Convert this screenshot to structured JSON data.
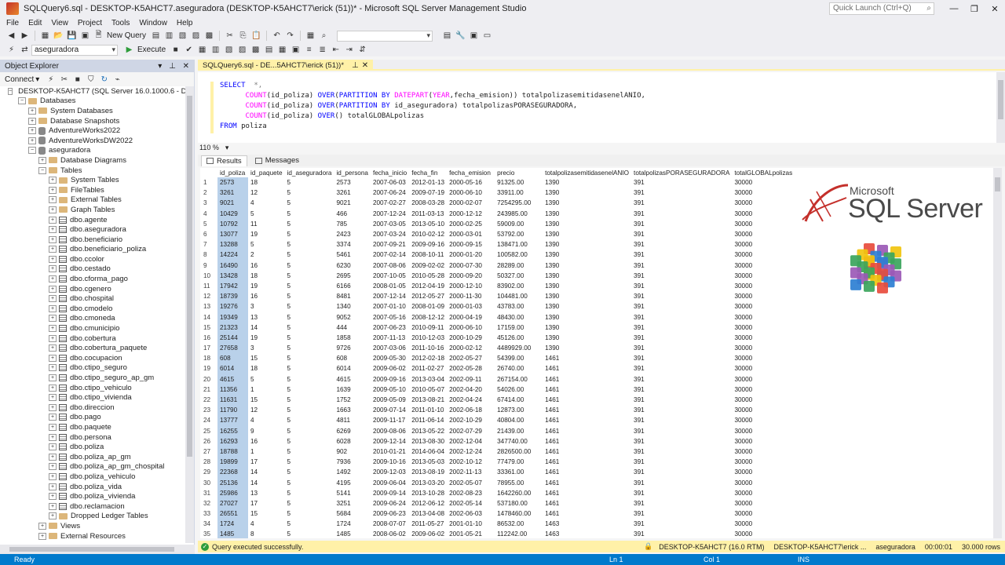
{
  "window": {
    "title": "SQLQuery6.sql - DESKTOP-K5AHCT7.aseguradora (DESKTOP-K5AHCT7\\erick (51))* - Microsoft SQL Server Management Studio",
    "quick_launch_placeholder": "Quick Launch (Ctrl+Q)"
  },
  "menu": [
    "File",
    "Edit",
    "View",
    "Project",
    "Tools",
    "Window",
    "Help"
  ],
  "toolbar": {
    "new_query": "New Query",
    "database": "aseguradora",
    "execute": "Execute"
  },
  "object_explorer": {
    "title": "Object Explorer",
    "connect": "Connect",
    "tree": [
      {
        "label": "DESKTOP-K5AHCT7 (SQL Server 16.0.1000.6 - DESKTOP-K",
        "level": 0,
        "icon": "server",
        "exp": "-"
      },
      {
        "label": "Databases",
        "level": 1,
        "icon": "folder",
        "exp": "-"
      },
      {
        "label": "System Databases",
        "level": 2,
        "icon": "folder",
        "exp": "+"
      },
      {
        "label": "Database Snapshots",
        "level": 2,
        "icon": "folder",
        "exp": "+"
      },
      {
        "label": "AdventureWorks2022",
        "level": 2,
        "icon": "db",
        "exp": "+"
      },
      {
        "label": "AdventureWorksDW2022",
        "level": 2,
        "icon": "db",
        "exp": "+"
      },
      {
        "label": "aseguradora",
        "level": 2,
        "icon": "db",
        "exp": "-"
      },
      {
        "label": "Database Diagrams",
        "level": 3,
        "icon": "folder",
        "exp": "+"
      },
      {
        "label": "Tables",
        "level": 3,
        "icon": "folder",
        "exp": "-"
      },
      {
        "label": "System Tables",
        "level": 4,
        "icon": "folder",
        "exp": "+"
      },
      {
        "label": "FileTables",
        "level": 4,
        "icon": "folder",
        "exp": "+"
      },
      {
        "label": "External Tables",
        "level": 4,
        "icon": "folder",
        "exp": "+"
      },
      {
        "label": "Graph Tables",
        "level": 4,
        "icon": "folder",
        "exp": "+"
      },
      {
        "label": "dbo.agente",
        "level": 4,
        "icon": "table",
        "exp": "+"
      },
      {
        "label": "dbo.aseguradora",
        "level": 4,
        "icon": "table",
        "exp": "+"
      },
      {
        "label": "dbo.beneficiario",
        "level": 4,
        "icon": "table",
        "exp": "+"
      },
      {
        "label": "dbo.beneficiario_poliza",
        "level": 4,
        "icon": "table",
        "exp": "+"
      },
      {
        "label": "dbo.ccolor",
        "level": 4,
        "icon": "table",
        "exp": "+"
      },
      {
        "label": "dbo.cestado",
        "level": 4,
        "icon": "table",
        "exp": "+"
      },
      {
        "label": "dbo.cforma_pago",
        "level": 4,
        "icon": "table",
        "exp": "+"
      },
      {
        "label": "dbo.cgenero",
        "level": 4,
        "icon": "table",
        "exp": "+"
      },
      {
        "label": "dbo.chospital",
        "level": 4,
        "icon": "table",
        "exp": "+"
      },
      {
        "label": "dbo.cmodelo",
        "level": 4,
        "icon": "table",
        "exp": "+"
      },
      {
        "label": "dbo.cmoneda",
        "level": 4,
        "icon": "table",
        "exp": "+"
      },
      {
        "label": "dbo.cmunicipio",
        "level": 4,
        "icon": "table",
        "exp": "+"
      },
      {
        "label": "dbo.cobertura",
        "level": 4,
        "icon": "table",
        "exp": "+"
      },
      {
        "label": "dbo.cobertura_paquete",
        "level": 4,
        "icon": "table",
        "exp": "+"
      },
      {
        "label": "dbo.cocupacion",
        "level": 4,
        "icon": "table",
        "exp": "+"
      },
      {
        "label": "dbo.ctipo_seguro",
        "level": 4,
        "icon": "table",
        "exp": "+"
      },
      {
        "label": "dbo.ctipo_seguro_ap_gm",
        "level": 4,
        "icon": "table",
        "exp": "+"
      },
      {
        "label": "dbo.ctipo_vehiculo",
        "level": 4,
        "icon": "table",
        "exp": "+"
      },
      {
        "label": "dbo.ctipo_vivienda",
        "level": 4,
        "icon": "table",
        "exp": "+"
      },
      {
        "label": "dbo.direccion",
        "level": 4,
        "icon": "table",
        "exp": "+"
      },
      {
        "label": "dbo.pago",
        "level": 4,
        "icon": "table",
        "exp": "+"
      },
      {
        "label": "dbo.paquete",
        "level": 4,
        "icon": "table",
        "exp": "+"
      },
      {
        "label": "dbo.persona",
        "level": 4,
        "icon": "table",
        "exp": "+"
      },
      {
        "label": "dbo.poliza",
        "level": 4,
        "icon": "table",
        "exp": "+"
      },
      {
        "label": "dbo.poliza_ap_gm",
        "level": 4,
        "icon": "table",
        "exp": "+"
      },
      {
        "label": "dbo.poliza_ap_gm_chospital",
        "level": 4,
        "icon": "table",
        "exp": "+"
      },
      {
        "label": "dbo.poliza_vehiculo",
        "level": 4,
        "icon": "table",
        "exp": "+"
      },
      {
        "label": "dbo.poliza_vida",
        "level": 4,
        "icon": "table",
        "exp": "+"
      },
      {
        "label": "dbo.poliza_vivienda",
        "level": 4,
        "icon": "table",
        "exp": "+"
      },
      {
        "label": "dbo.reclamacion",
        "level": 4,
        "icon": "table",
        "exp": "+"
      },
      {
        "label": "Dropped Ledger Tables",
        "level": 4,
        "icon": "folder",
        "exp": "+"
      },
      {
        "label": "Views",
        "level": 3,
        "icon": "folder",
        "exp": "+"
      },
      {
        "label": "External Resources",
        "level": 3,
        "icon": "folder",
        "exp": "+"
      }
    ]
  },
  "editor": {
    "tab_label": "SQLQuery6.sql - DE...5AHCT7\\erick (51))*",
    "zoom": "110 %"
  },
  "results": {
    "tabs": [
      "Results",
      "Messages"
    ],
    "columns": [
      "id_poliza",
      "id_paquete",
      "id_aseguradora",
      "id_persona",
      "fecha_inicio",
      "fecha_fin",
      "fecha_emision",
      "precio",
      "totalpolizasemitidasenelANIO",
      "totalpolizasPORASEGURADORA",
      "totalGLOBALpolizas"
    ],
    "rows": [
      [
        "1",
        "2573",
        "18",
        "5",
        "2573",
        "2007-06-03",
        "2012-01-13",
        "2000-05-16",
        "91325.00",
        "1390",
        "391",
        "30000"
      ],
      [
        "2",
        "3261",
        "12",
        "5",
        "3261",
        "2007-06-24",
        "2009-07-19",
        "2000-06-10",
        "33911.00",
        "1390",
        "391",
        "30000"
      ],
      [
        "3",
        "9021",
        "4",
        "5",
        "9021",
        "2007-02-27",
        "2008-03-28",
        "2000-02-07",
        "7254295.00",
        "1390",
        "391",
        "30000"
      ],
      [
        "4",
        "10429",
        "5",
        "5",
        "466",
        "2007-12-24",
        "2011-03-13",
        "2000-12-12",
        "243985.00",
        "1390",
        "391",
        "30000"
      ],
      [
        "5",
        "10792",
        "11",
        "5",
        "785",
        "2007-03-05",
        "2013-05-10",
        "2000-02-25",
        "59009.00",
        "1390",
        "391",
        "30000"
      ],
      [
        "6",
        "13077",
        "19",
        "5",
        "2423",
        "2007-03-24",
        "2010-02-12",
        "2000-03-01",
        "53792.00",
        "1390",
        "391",
        "30000"
      ],
      [
        "7",
        "13288",
        "5",
        "5",
        "3374",
        "2007-09-21",
        "2009-09-16",
        "2000-09-15",
        "138471.00",
        "1390",
        "391",
        "30000"
      ],
      [
        "8",
        "14224",
        "2",
        "5",
        "5461",
        "2007-02-14",
        "2008-10-11",
        "2000-01-20",
        "100582.00",
        "1390",
        "391",
        "30000"
      ],
      [
        "9",
        "16490",
        "16",
        "5",
        "6230",
        "2007-08-06",
        "2009-02-02",
        "2000-07-30",
        "28289.00",
        "1390",
        "391",
        "30000"
      ],
      [
        "10",
        "13428",
        "18",
        "5",
        "2695",
        "2007-10-05",
        "2010-05-28",
        "2000-09-20",
        "50327.00",
        "1390",
        "391",
        "30000"
      ],
      [
        "11",
        "17942",
        "19",
        "5",
        "6166",
        "2008-01-05",
        "2012-04-19",
        "2000-12-10",
        "83902.00",
        "1390",
        "391",
        "30000"
      ],
      [
        "12",
        "18739",
        "16",
        "5",
        "8481",
        "2007-12-14",
        "2012-05-27",
        "2000-11-30",
        "104481.00",
        "1390",
        "391",
        "30000"
      ],
      [
        "13",
        "19276",
        "3",
        "5",
        "1340",
        "2007-01-10",
        "2008-01-09",
        "2000-01-03",
        "43783.00",
        "1390",
        "391",
        "30000"
      ],
      [
        "14",
        "19349",
        "13",
        "5",
        "9052",
        "2007-05-16",
        "2008-12-12",
        "2000-04-19",
        "48430.00",
        "1390",
        "391",
        "30000"
      ],
      [
        "15",
        "21323",
        "14",
        "5",
        "444",
        "2007-06-23",
        "2010-09-11",
        "2000-06-10",
        "17159.00",
        "1390",
        "391",
        "30000"
      ],
      [
        "16",
        "25144",
        "19",
        "5",
        "1858",
        "2007-11-13",
        "2010-12-03",
        "2000-10-29",
        "45126.00",
        "1390",
        "391",
        "30000"
      ],
      [
        "17",
        "27658",
        "3",
        "5",
        "9726",
        "2007-03-06",
        "2011-10-16",
        "2000-02-12",
        "4489929.00",
        "1390",
        "391",
        "30000"
      ],
      [
        "18",
        "608",
        "15",
        "5",
        "608",
        "2009-05-30",
        "2012-02-18",
        "2002-05-27",
        "54399.00",
        "1461",
        "391",
        "30000"
      ],
      [
        "19",
        "6014",
        "18",
        "5",
        "6014",
        "2009-06-02",
        "2011-02-27",
        "2002-05-28",
        "26740.00",
        "1461",
        "391",
        "30000"
      ],
      [
        "20",
        "4615",
        "5",
        "5",
        "4615",
        "2009-09-16",
        "2013-03-04",
        "2002-09-11",
        "267154.00",
        "1461",
        "391",
        "30000"
      ],
      [
        "21",
        "11356",
        "1",
        "5",
        "1639",
        "2009-05-10",
        "2010-05-07",
        "2002-04-20",
        "54026.00",
        "1461",
        "391",
        "30000"
      ],
      [
        "22",
        "11631",
        "15",
        "5",
        "1752",
        "2009-05-09",
        "2013-08-21",
        "2002-04-24",
        "67414.00",
        "1461",
        "391",
        "30000"
      ],
      [
        "23",
        "11790",
        "12",
        "5",
        "1663",
        "2009-07-14",
        "2011-01-10",
        "2002-06-18",
        "12873.00",
        "1461",
        "391",
        "30000"
      ],
      [
        "24",
        "13777",
        "4",
        "5",
        "4811",
        "2009-11-17",
        "2011-06-14",
        "2002-10-29",
        "40804.00",
        "1461",
        "391",
        "30000"
      ],
      [
        "25",
        "16255",
        "9",
        "5",
        "6269",
        "2009-08-06",
        "2013-05-22",
        "2002-07-29",
        "21439.00",
        "1461",
        "391",
        "30000"
      ],
      [
        "26",
        "16293",
        "16",
        "5",
        "6028",
        "2009-12-14",
        "2013-08-30",
        "2002-12-04",
        "347740.00",
        "1461",
        "391",
        "30000"
      ],
      [
        "27",
        "18788",
        "1",
        "5",
        "902",
        "2010-01-21",
        "2014-06-04",
        "2002-12-24",
        "2826500.00",
        "1461",
        "391",
        "30000"
      ],
      [
        "28",
        "19899",
        "17",
        "5",
        "7936",
        "2009-10-16",
        "2013-05-03",
        "2002-10-12",
        "77479.00",
        "1461",
        "391",
        "30000"
      ],
      [
        "29",
        "22368",
        "14",
        "5",
        "1492",
        "2009-12-03",
        "2013-08-19",
        "2002-11-13",
        "33361.00",
        "1461",
        "391",
        "30000"
      ],
      [
        "30",
        "25136",
        "14",
        "5",
        "4195",
        "2009-06-04",
        "2013-03-20",
        "2002-05-07",
        "78955.00",
        "1461",
        "391",
        "30000"
      ],
      [
        "31",
        "25986",
        "13",
        "5",
        "5141",
        "2009-09-14",
        "2013-10-28",
        "2002-08-23",
        "1642260.00",
        "1461",
        "391",
        "30000"
      ],
      [
        "32",
        "27027",
        "17",
        "5",
        "3251",
        "2009-06-24",
        "2012-06-12",
        "2002-05-14",
        "537180.00",
        "1461",
        "391",
        "30000"
      ],
      [
        "33",
        "26551",
        "15",
        "5",
        "5684",
        "2009-06-23",
        "2013-04-08",
        "2002-06-03",
        "1478460.00",
        "1461",
        "391",
        "30000"
      ],
      [
        "34",
        "1724",
        "4",
        "5",
        "1724",
        "2008-07-07",
        "2011-05-27",
        "2001-01-10",
        "86532.00",
        "1463",
        "391",
        "30000"
      ],
      [
        "35",
        "1485",
        "8",
        "5",
        "1485",
        "2008-06-02",
        "2009-06-02",
        "2001-05-21",
        "112242.00",
        "1463",
        "391",
        "30000"
      ]
    ]
  },
  "logo": {
    "line1": "Microsoft",
    "line2": "SQL Server",
    "colors": [
      "#e84c3d",
      "#3ba55c",
      "#2d7fd3",
      "#f1c40f",
      "#9b59b6"
    ]
  },
  "query_status": {
    "message": "Query executed successfully.",
    "server": "DESKTOP-K5AHCT7 (16.0 RTM)",
    "user": "DESKTOP-K5AHCT7\\erick ...",
    "database": "aseguradora",
    "time": "00:00:01",
    "rows": "30.000 rows"
  },
  "statusbar": {
    "ready": "Ready",
    "ln": "Ln 1",
    "col": "Col 1",
    "ins": "INS"
  },
  "colors": {
    "accent_blue": "#007acc",
    "tab_yellow": "#fff1a8",
    "panel_header": "#cfd6e5",
    "selection": "#b9d1ea"
  }
}
